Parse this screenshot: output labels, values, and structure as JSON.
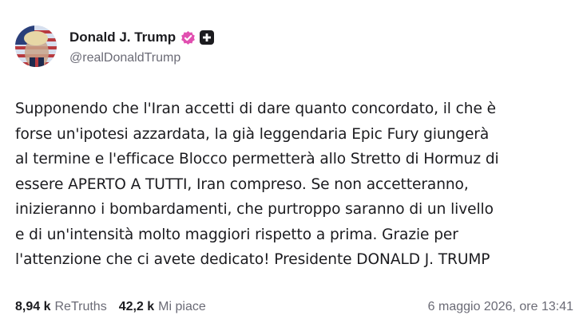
{
  "author": {
    "display_name": "Donald J. Trump",
    "handle": "@realDonaldTrump",
    "verified_icon": "verified-badge-icon",
    "badge_icon": "plus-badge-icon",
    "verified_color": "#e14fb0"
  },
  "post": {
    "text": "Supponendo che l'Iran accetti di dare quanto concordato, il che è\nforse un'ipotesi azzardata, la già leggendaria Epic Fury giungerà\nal termine e l'efficace Blocco permetterà allo Stretto di Hormuz di\nessere APERTO A TUTTI, Iran compreso. Se non accetteranno,\ninizieranno i bombardamenti, che purtroppo saranno di un livello\ne di un'intensità molto maggiori rispetto a prima. Grazie per\nl'attenzione che ci avete dedicato! Presidente DONALD J. TRUMP"
  },
  "stats": {
    "retruths_count": "8,94 k",
    "retruths_label": "ReTruths",
    "likes_count": "42,2 k",
    "likes_label": "Mi piace"
  },
  "timestamp": "6 maggio 2026, ore 13:41"
}
